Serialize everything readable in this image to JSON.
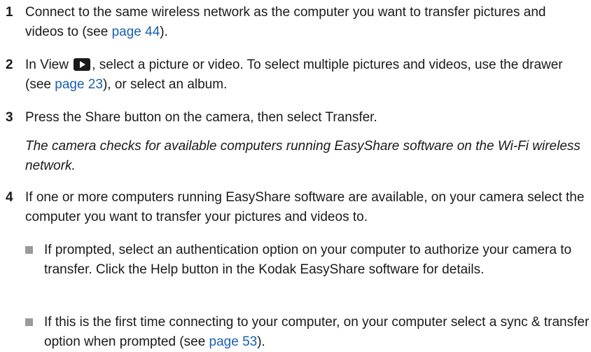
{
  "steps": [
    {
      "number": "1",
      "text_before": "Connect to the same wireless network as the computer you want to transfer pictures and videos to (see ",
      "link": "page 44",
      "text_after": ")."
    },
    {
      "number": "2",
      "text_before": "In View ",
      "icon": "play-icon",
      "text_mid": ", select a picture or video. To select multiple pictures and videos, use the drawer (see ",
      "link": "page 23",
      "text_after": "), or select an album."
    },
    {
      "number": "3",
      "text": "Press the Share button on the camera, then select Transfer.",
      "note": "The camera checks for available computers running EasyShare software on the Wi-Fi wireless network."
    },
    {
      "number": "4",
      "text": "If one or more computers running EasyShare software are available, on your camera select the computer you want to transfer your pictures and videos to."
    }
  ],
  "bullets": [
    {
      "text": "If prompted, select an authentication option on your computer to authorize your camera to transfer. Click the Help button in the Kodak EasyShare software for details."
    },
    {
      "text_before": "If this is the first time connecting to your computer, on your computer select a sync & transfer option when prompted (see ",
      "link": "page 53",
      "text_after": ")."
    }
  ],
  "colors": {
    "link": "#1a5fb4",
    "bullet": "#9a9a9a",
    "text": "#1a1a1a"
  }
}
